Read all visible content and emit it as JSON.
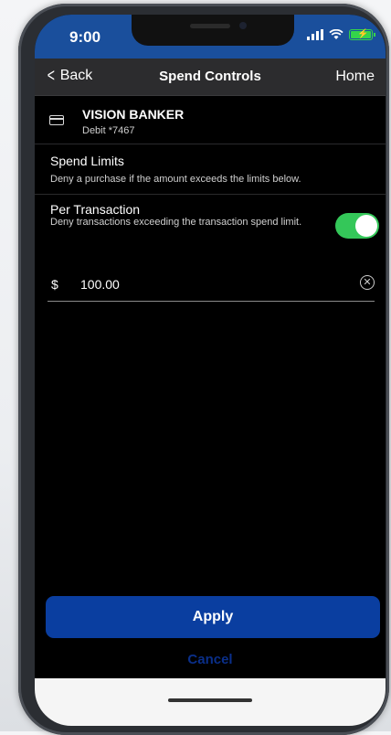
{
  "status_bar": {
    "time": "9:00",
    "accent": "#1a4f9c"
  },
  "nav": {
    "back_label": "Back",
    "title": "Spend Controls",
    "home_label": "Home"
  },
  "card": {
    "name": "VISION BANKER",
    "number": "Debit *7467"
  },
  "spend_limits": {
    "heading": "Spend Limits",
    "description": "Deny a purchase if the amount exceeds the limits below."
  },
  "per_transaction": {
    "heading": "Per Transaction",
    "description": "Deny transactions exceeding the transaction spend limit.",
    "enabled": true,
    "toggle_color": "#34c759"
  },
  "amount_field": {
    "currency": "$",
    "value": "100.00"
  },
  "actions": {
    "apply_label": "Apply",
    "cancel_label": "Cancel",
    "apply_color": "#0a3ea0"
  },
  "icons": [
    "chevron-left-icon",
    "card-icon",
    "clear-icon",
    "signal-icon",
    "wifi-icon",
    "battery-icon"
  ]
}
